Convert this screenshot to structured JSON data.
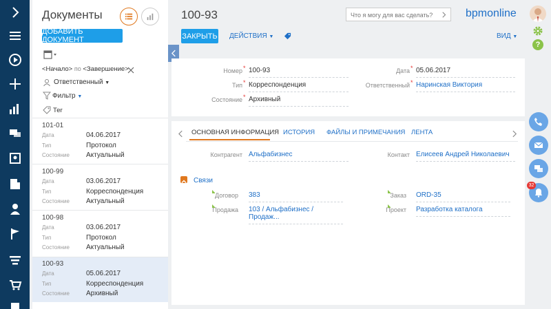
{
  "left_panel": {
    "title": "Документы",
    "add_button": "ДОБАВИТЬ ДОКУМЕНТ",
    "period": {
      "start": "<Начало>",
      "sep": "по",
      "end": "<Завершение>"
    },
    "responsible": "Ответственный",
    "filter": "Фильтр",
    "tag": "Тег",
    "items": [
      {
        "title": "101-01",
        "date_label": "Дата",
        "date": "04.06.2017",
        "type_label": "Тип",
        "type": "Протокол",
        "state_label": "Состояние",
        "state": "Актуальный"
      },
      {
        "title": "100-99",
        "date_label": "Дата",
        "date": "03.06.2017",
        "type_label": "Тип",
        "type": "Корреспонденция",
        "state_label": "Состояние",
        "state": "Актуальный"
      },
      {
        "title": "100-98",
        "date_label": "Дата",
        "date": "03.06.2017",
        "type_label": "Тип",
        "type": "Протокол",
        "state_label": "Состояние",
        "state": "Актуальный"
      },
      {
        "title": "100-93",
        "date_label": "Дата",
        "date": "05.06.2017",
        "type_label": "Тип",
        "type": "Корреспонденция",
        "state_label": "Состояние",
        "state": "Архивный"
      }
    ]
  },
  "header": {
    "record_title": "100-93",
    "search_placeholder": "Что я могу для вас сделать?",
    "logo": "bpmonline",
    "close_button": "ЗАКРЫТЬ",
    "actions_button": "ДЕЙСТВИЯ",
    "view_button": "ВИД"
  },
  "fields": {
    "number_label": "Номер",
    "number": "100-93",
    "type_label": "Тип",
    "type": "Корреспонденция",
    "state_label": "Состояние",
    "state": "Архивный",
    "date_label": "Дата",
    "date": "05.06.2017",
    "owner_label": "Ответственный",
    "owner": "Наринская Виктория"
  },
  "tabs": [
    "ОСНОВНАЯ ИНФОРМАЦИЯ",
    "ИСТОРИЯ",
    "ФАЙЛЫ И ПРИМЕЧАНИЯ",
    "ЛЕНТА"
  ],
  "main_info": {
    "contractor_label": "Контрагент",
    "contractor": "Альфабизнес",
    "contact_label": "Контакт",
    "contact": "Елисеев Андрей Николаевич",
    "links_title": "Связи",
    "contract_label": "Договор",
    "contract": "383",
    "sale_label": "Продажа",
    "sale": "103 / Альфабизнес / Продаж...",
    "order_label": "Заказ",
    "order": "ORD-35",
    "project_label": "Проект",
    "project": "Разработка каталога"
  },
  "notifications": {
    "badge": "32"
  },
  "colors": {
    "nav": "#0e3a5f",
    "accent": "#1e9ee8",
    "selected": "#e4ecf7",
    "link": "#1e6fc7",
    "tab_active": "#e0781e"
  }
}
